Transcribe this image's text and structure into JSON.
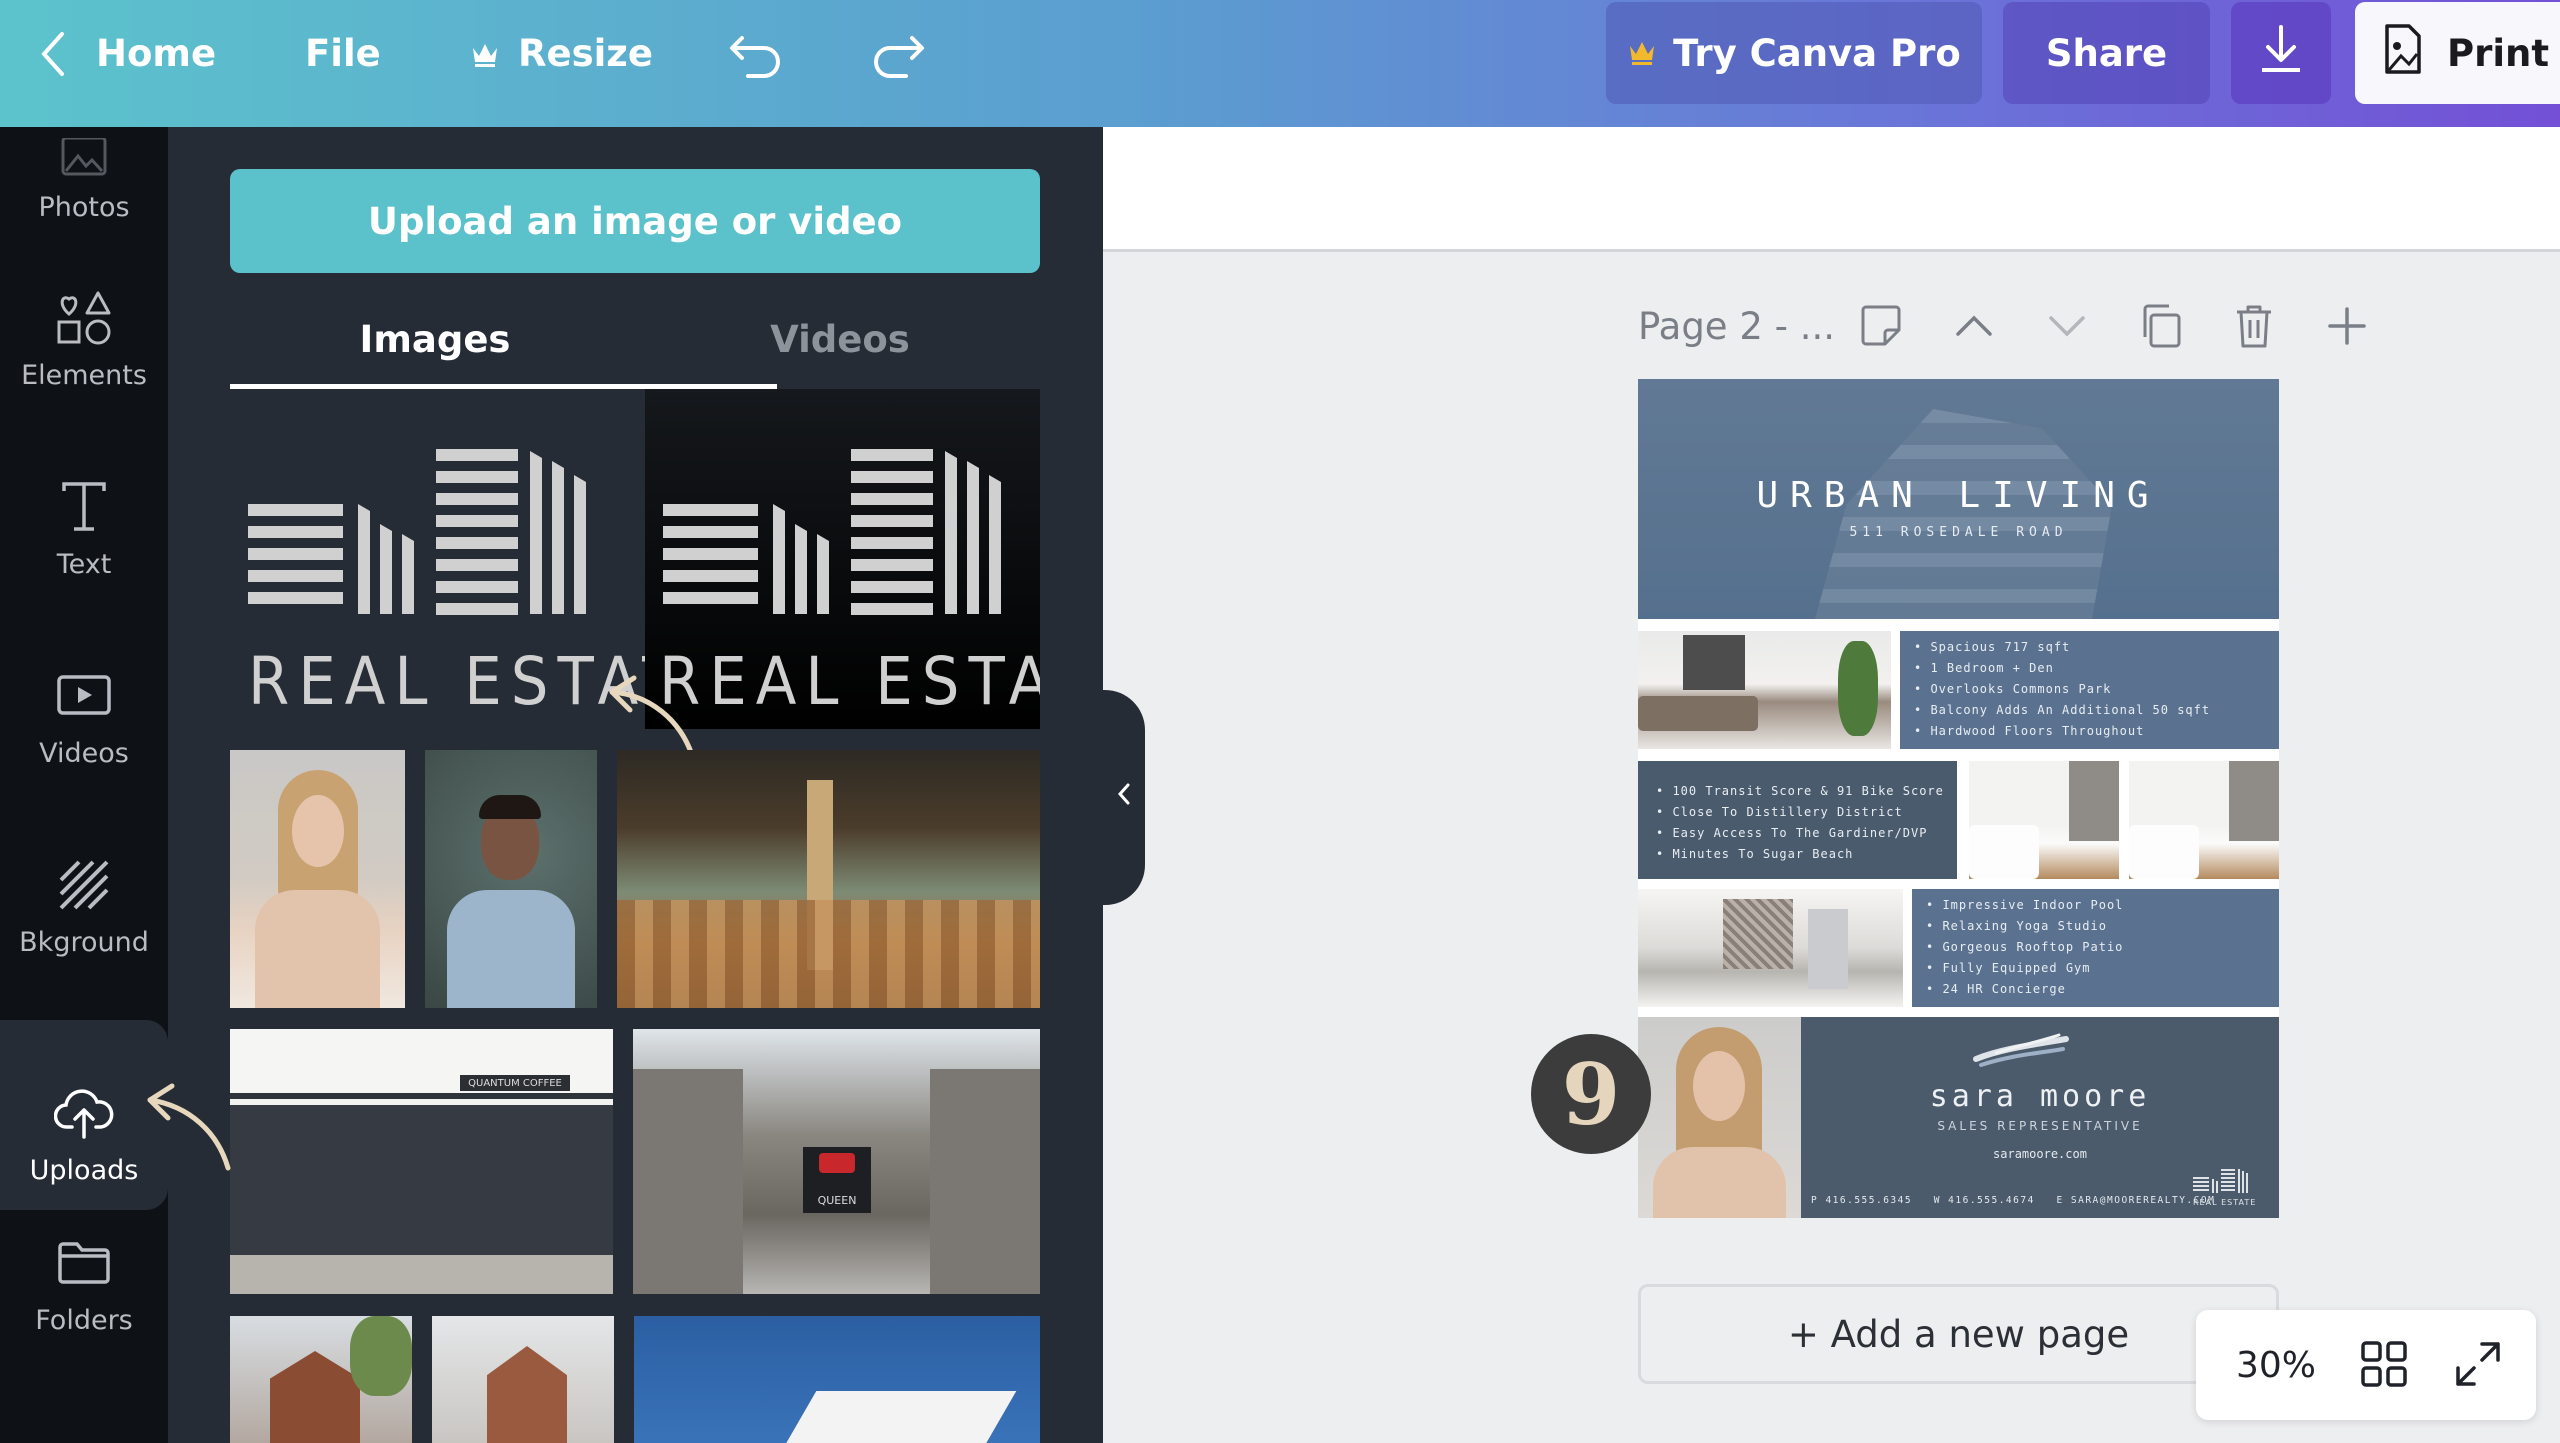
{
  "topbar": {
    "home_label": "Home",
    "file_label": "File",
    "resize_label": "Resize",
    "try_pro_label": "Try Canva Pro",
    "share_label": "Share",
    "print_label": "Print F",
    "colors": {
      "gradient_start": "#5cc3cc",
      "gradient_end": "#7350d6",
      "crown": "#f2b92c"
    }
  },
  "sidebar": {
    "items": [
      {
        "label": "Photos",
        "icon": "photo-icon"
      },
      {
        "label": "Elements",
        "icon": "shapes-icon"
      },
      {
        "label": "Text",
        "icon": "text-icon"
      },
      {
        "label": "Videos",
        "icon": "video-icon"
      },
      {
        "label": "Bkground",
        "icon": "background-icon"
      },
      {
        "label": "Uploads",
        "icon": "upload-cloud-icon",
        "active": true
      },
      {
        "label": "Folders",
        "icon": "folder-icon"
      }
    ]
  },
  "panel": {
    "upload_button": "Upload an image or video",
    "tabs": [
      {
        "label": "Images",
        "active": true
      },
      {
        "label": "Videos",
        "active": false
      }
    ],
    "uploads": [
      {
        "alt": "Real Estate logo (dark background)",
        "text": "REAL ESTATE"
      },
      {
        "alt": "Real Estate logo (black background)",
        "text": "REAL ESTATE"
      },
      {
        "alt": "Portrait of blonde woman"
      },
      {
        "alt": "Portrait of smiling man"
      },
      {
        "alt": "Restaurant interior"
      },
      {
        "alt": "Quantum Coffee storefront",
        "text": "QUANTUM COFFEE"
      },
      {
        "alt": "Queen subway station entrance",
        "text": "QUEEN"
      },
      {
        "alt": "Flatiron building"
      },
      {
        "alt": "Flatiron building foggy"
      },
      {
        "alt": "Modern building against blue sky"
      }
    ]
  },
  "canvas": {
    "page_title": "Page 2 - ...",
    "add_page_label": "+ Add a new page",
    "zoom_level": "30%",
    "badge_number": "9"
  },
  "flyer": {
    "title": "URBAN LIVING",
    "address": "511 ROSEDALE ROAD",
    "features_1": [
      "Spacious 717 sqft",
      "1 Bedroom + Den",
      "Overlooks Commons Park",
      "Balcony Adds An Additional 50 sqft",
      "Hardwood Floors Throughout"
    ],
    "features_2": [
      "100 Transit Score & 91 Bike Score",
      "Close To Distillery District",
      "Easy Access To The Gardiner/DVP",
      "Minutes To Sugar Beach"
    ],
    "features_3": [
      "Impressive Indoor Pool",
      "Relaxing Yoga Studio",
      "Gorgeous Rooftop Patio",
      "Fully Equipped Gym",
      "24 HR Concierge"
    ],
    "agent_name": "sara moore",
    "agent_role": "SALES REPRESENTATIVE",
    "website": "saramoore.com",
    "contact_line": "P 416.555.6345   W 416.555.4674   E SARA@MOOREREALTY.COM",
    "logo_text": "REAL ESTATE",
    "colors": {
      "blue": "#5a7290",
      "slate": "#4a5a6c"
    }
  }
}
